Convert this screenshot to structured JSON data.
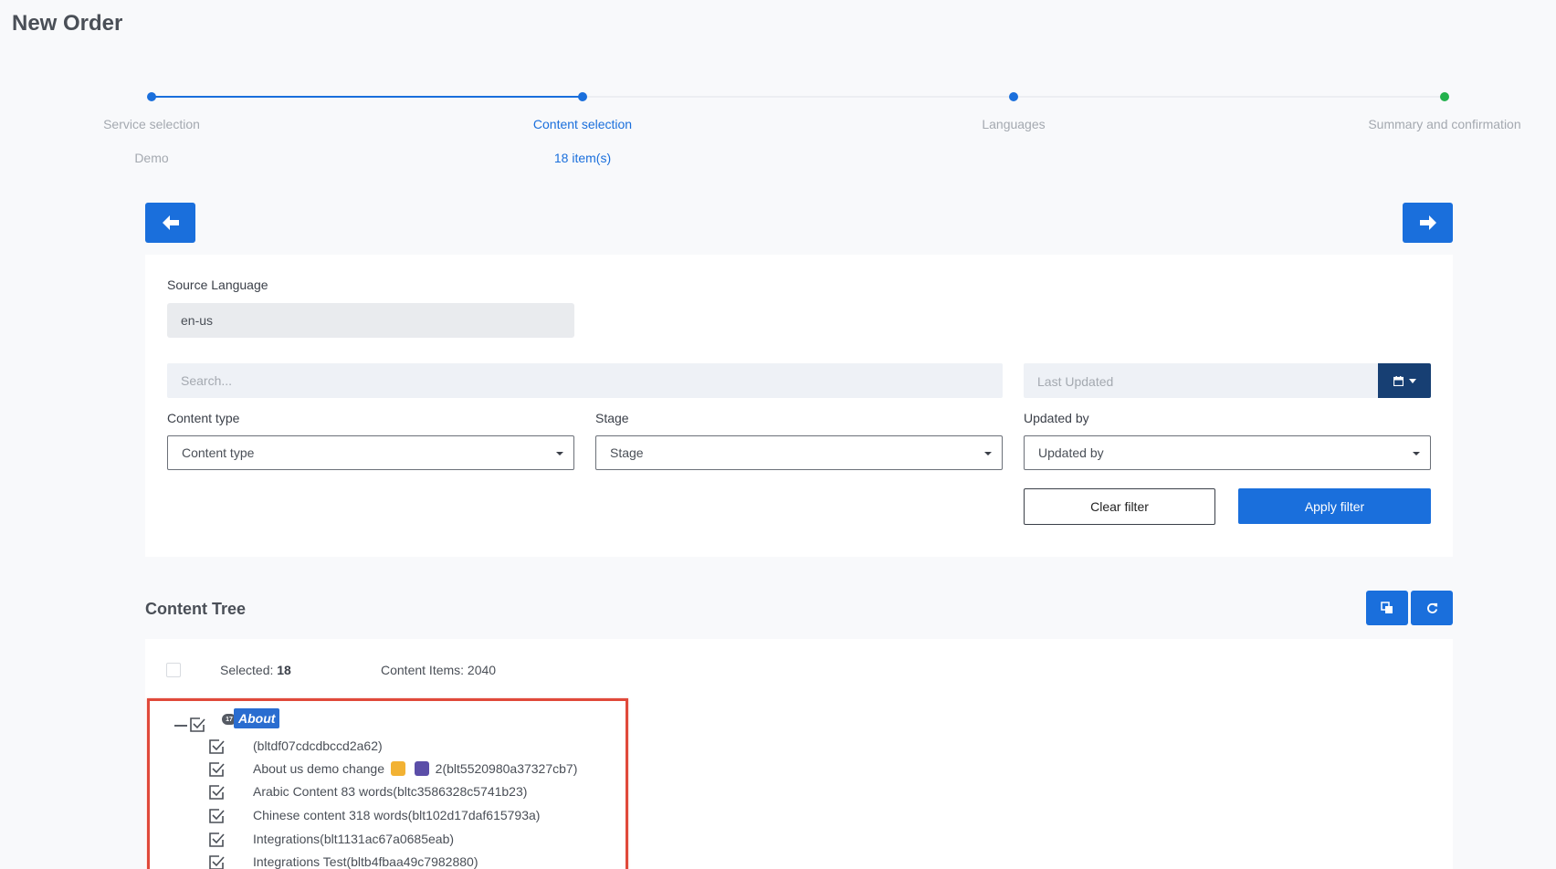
{
  "page": {
    "title": "New Order"
  },
  "stepper": {
    "steps": [
      {
        "label": "Service selection",
        "sub": "Demo"
      },
      {
        "label": "Content selection",
        "sub": "18 item(s)"
      },
      {
        "label": "Languages",
        "sub": ""
      },
      {
        "label": "Summary and confirmation",
        "sub": ""
      }
    ]
  },
  "nav": {
    "back_icon": "arrow-left-icon",
    "next_icon": "arrow-right-icon"
  },
  "filters": {
    "source_language_label": "Source Language",
    "source_language_value": "en-us",
    "search_placeholder": "Search...",
    "last_updated_placeholder": "Last Updated",
    "calendar_icon": "calendar-icon",
    "content_type_label": "Content type",
    "content_type_value": "Content type",
    "stage_label": "Stage",
    "stage_value": "Stage",
    "updated_by_label": "Updated by",
    "updated_by_value": "Updated by",
    "clear_label": "Clear filter",
    "apply_label": "Apply filter"
  },
  "content_tree": {
    "title": "Content Tree",
    "copy_icon": "copy-icon",
    "refresh_icon": "refresh-icon",
    "selected_label": "Selected:",
    "selected_count": "18",
    "items_label": "Content Items: 2040",
    "root": {
      "label": "About",
      "badge": "17"
    },
    "items": [
      {
        "prefix": "(bltdf07cdcdbccd2a62)",
        "suffix": ""
      },
      {
        "prefix": "About us demo change ",
        "suffix": " 2(blt5520980a37327cb7)"
      },
      {
        "prefix": "Arabic Content 83 words(bltc3586328c5741b23)",
        "suffix": ""
      },
      {
        "prefix": "Chinese content 318 words(blt102d17daf615793a)",
        "suffix": ""
      },
      {
        "prefix": "Integrations(blt1131ac67a0685eab)",
        "suffix": ""
      },
      {
        "prefix": "Integrations Test(bltb4fbaa49c7982880)",
        "suffix": ""
      }
    ]
  },
  "colors": {
    "primary": "#1a6fdc",
    "dark": "#173f73",
    "highlight": "#e0493a",
    "complete": "#22b14c"
  }
}
